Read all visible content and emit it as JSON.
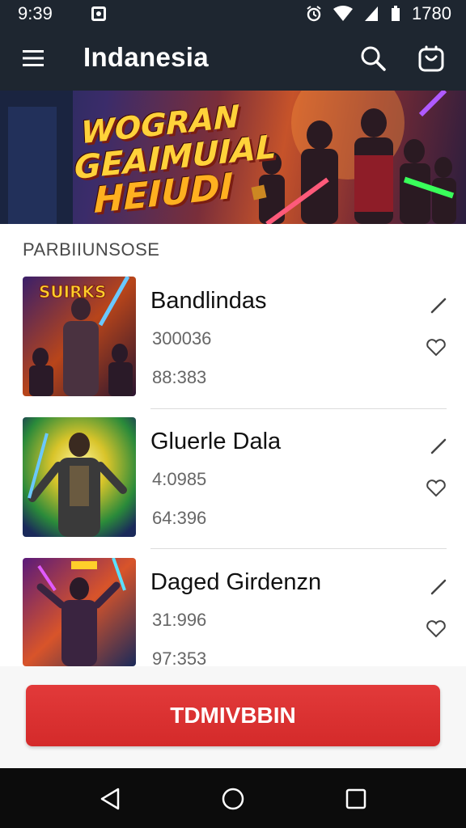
{
  "status_bar": {
    "time": "9:39",
    "battery_text": "1780"
  },
  "app_bar": {
    "title": "Indanesia",
    "icons": [
      "menu-icon",
      "search-icon",
      "shopping-bag-icon"
    ]
  },
  "banner": {
    "line1": "WOGRAN",
    "line2": "GEAIMUIAL",
    "line3": "HEIUDI"
  },
  "section": {
    "title": "PARBIIUNSOSE"
  },
  "items": [
    {
      "name": "Bandlindas",
      "stat1": "300036",
      "stat2": "88:383",
      "thumb_label": "SUIRKS"
    },
    {
      "name": "Gluerle Dala",
      "stat1": "4:0985",
      "stat2": "64:396",
      "thumb_label": ""
    },
    {
      "name": "Daged Girdenzn",
      "stat1": "31:996",
      "stat2": "97:353",
      "thumb_label": ""
    }
  ],
  "cta": {
    "label": "TDMIVBBIN"
  },
  "nav": {
    "icons": [
      "back-icon",
      "home-icon",
      "recents-icon"
    ]
  },
  "colors": {
    "app_bar": "#1e2630",
    "cta": "#d42a2a"
  }
}
